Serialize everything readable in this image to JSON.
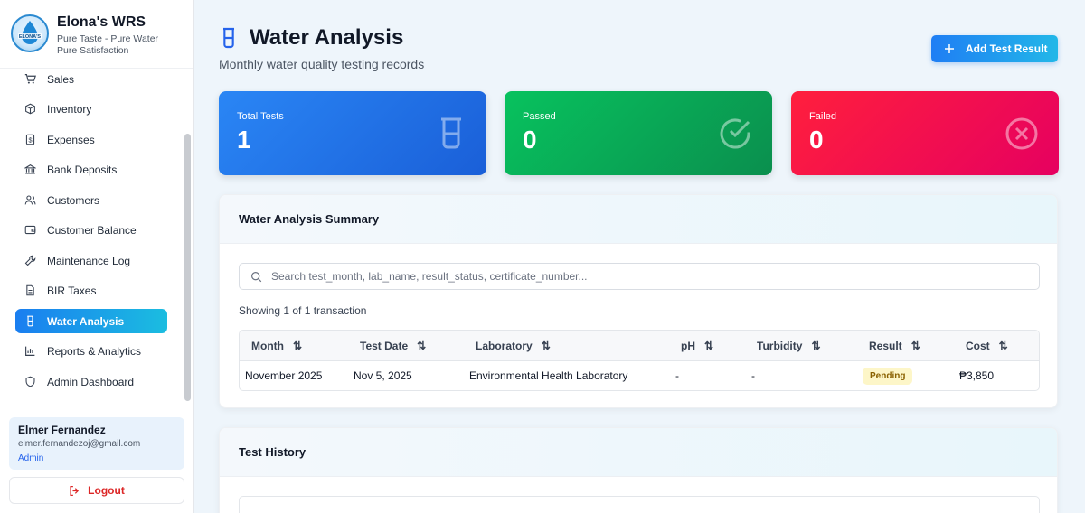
{
  "brand": {
    "name": "Elona's WRS",
    "tagline1": "Pure Taste - Pure Water",
    "tagline2": "Pure Satisfaction",
    "logo_text": "ELONA'S"
  },
  "sidebar": {
    "items": [
      {
        "label": "Sales",
        "icon": "cart-icon"
      },
      {
        "label": "Inventory",
        "icon": "box-icon"
      },
      {
        "label": "Expenses",
        "icon": "receipt-icon"
      },
      {
        "label": "Bank Deposits",
        "icon": "bank-icon"
      },
      {
        "label": "Customers",
        "icon": "users-icon"
      },
      {
        "label": "Customer Balance",
        "icon": "wallet-icon"
      },
      {
        "label": "Maintenance Log",
        "icon": "wrench-icon"
      },
      {
        "label": "BIR Taxes",
        "icon": "document-icon"
      },
      {
        "label": "Water Analysis",
        "icon": "beaker-icon",
        "active": true
      },
      {
        "label": "Reports & Analytics",
        "icon": "chart-icon"
      },
      {
        "label": "Admin Dashboard",
        "icon": "shield-icon"
      }
    ]
  },
  "user": {
    "name": "Elmer Fernandez",
    "email": "elmer.fernandezoj@gmail.com",
    "role": "Admin"
  },
  "logout_label": "Logout",
  "page": {
    "title": "Water Analysis",
    "subtitle": "Monthly water quality testing records",
    "add_button": "Add Test Result"
  },
  "stats": {
    "total": {
      "label": "Total Tests",
      "value": "1"
    },
    "passed": {
      "label": "Passed",
      "value": "0"
    },
    "failed": {
      "label": "Failed",
      "value": "0"
    }
  },
  "summary": {
    "title": "Water Analysis Summary",
    "search_placeholder": "Search test_month, lab_name, result_status, certificate_number...",
    "showing": "Showing 1 of 1 transaction",
    "columns": [
      "Month",
      "Test Date",
      "Laboratory",
      "pH",
      "Turbidity",
      "Result",
      "Cost"
    ],
    "rows": [
      {
        "month": "November 2025",
        "test_date": "Nov 5, 2025",
        "laboratory": "Environmental Health Laboratory",
        "ph": "-",
        "turbidity": "-",
        "result": "Pending",
        "cost": "₱3,850"
      }
    ]
  },
  "history": {
    "title": "Test History"
  },
  "colors": {
    "accent": "#1a7ef0",
    "passed": "#08c25e",
    "failed": "#ff1f3d",
    "pending_badge": "#fdf6c8"
  }
}
